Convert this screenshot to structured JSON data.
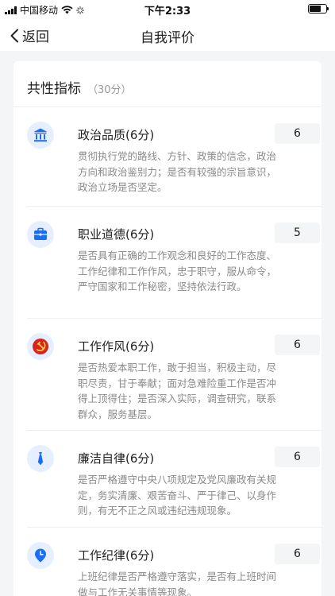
{
  "status_bar": {
    "carrier": "中国移动",
    "time": "下午2:33",
    "battery_level": 0.7
  },
  "nav": {
    "back_label": "返回",
    "title": "自我评价"
  },
  "section": {
    "title": "共性指标",
    "score_note": "（30分）"
  },
  "items": [
    {
      "icon": "government-building-icon",
      "name": "政治品质(6分)",
      "desc": "贯彻执行党的路线、方针、政策的信念，政治方向和政治鉴别力；是否有较强的宗旨意识，政治立场是否坚定。",
      "score": "6"
    },
    {
      "icon": "briefcase-icon",
      "name": "职业道德(6分)",
      "desc": "是否具有正确的工作观念和良好的工作态度、工作纪律和工作作风，忠于职守，服从命令，严守国家和工作秘密，坚持依法行政。",
      "score": "5"
    },
    {
      "icon": "hammer-sickle-icon",
      "name": "工作作风(6分)",
      "desc": "是否热爱本职工作，敢于担当，积极主动，尽职尽责，甘于奉献；面对急难险重工作是否冲得上顶得住；是否深入实际，调查研究，联系群众，服务基层。",
      "score": "6"
    },
    {
      "icon": "necktie-icon",
      "name": "廉洁自律(6分)",
      "desc": "是否严格遵守中央八项规定及党风廉政有关规定，务实清廉、艰苦奋斗、严于律己、以身作则，有无不正之风或违纪违规现象。",
      "score": "6"
    },
    {
      "icon": "clock-pin-icon",
      "name": "工作纪律(6分)",
      "desc": "上班纪律是否严格遵守落实，是否有上班时间做与工作无关事情等现象。",
      "score": "6"
    }
  ],
  "colors": {
    "accent": "#1a6ef5",
    "icon_bg": "#e6efff",
    "background": "#f4f5f7"
  }
}
